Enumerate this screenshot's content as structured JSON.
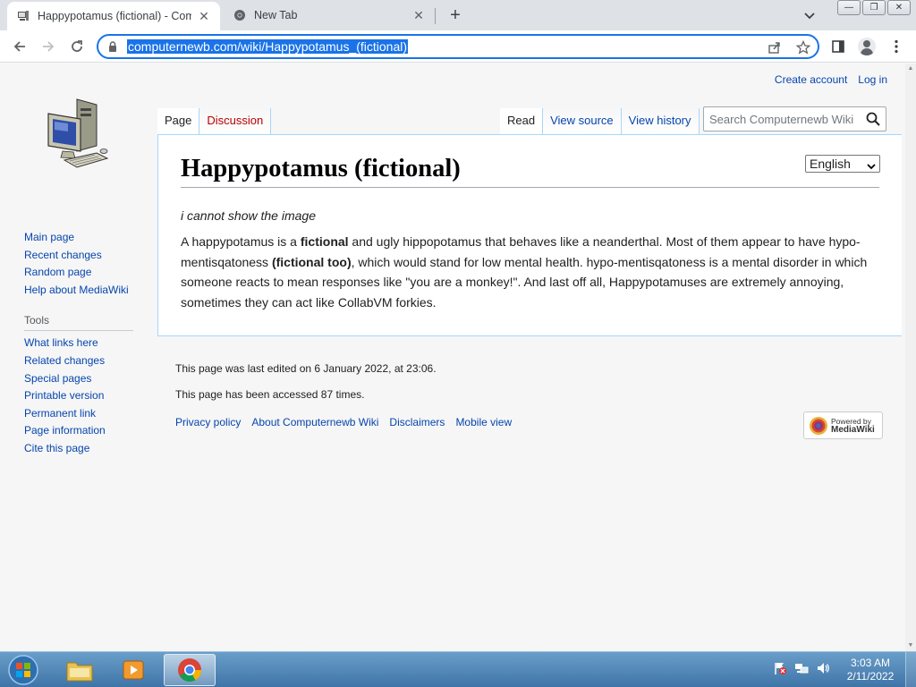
{
  "browser": {
    "tabs": [
      {
        "title": "Happypotamus (fictional) - Comp",
        "active": true
      },
      {
        "title": "New Tab",
        "active": false
      }
    ],
    "url": "computernewb.com/wiki/Happypotamus_(fictional)"
  },
  "wiki": {
    "personal": {
      "create_account": "Create account",
      "log_in": "Log in"
    },
    "nav_tabs_left": [
      "Page",
      "Discussion"
    ],
    "nav_tabs_right": [
      "Read",
      "View source",
      "View history"
    ],
    "search_placeholder": "Search Computernewb Wiki",
    "sidebar": {
      "navigation": [
        "Main page",
        "Recent changes",
        "Random page",
        "Help about MediaWiki"
      ],
      "tools_title": "Tools",
      "tools": [
        "What links here",
        "Related changes",
        "Special pages",
        "Printable version",
        "Permanent link",
        "Page information",
        "Cite this page"
      ]
    },
    "heading": "Happypotamus (fictional)",
    "language": "English",
    "image_alt": "i cannot show the image",
    "paragraph": {
      "p1": "A happypotamus is a ",
      "b1": "fictional",
      "p2": " and ugly hippopotamus that behaves like a neanderthal. Most of them appear to have hypo-mentisqatoness ",
      "b2": "(fictional too)",
      "p3": ", which would stand for low mental health. hypo-mentisqatoness is a mental disorder in which someone reacts to mean responses like \"you are a monkey!\". And last off all, Happypotamuses are extremely annoying, sometimes they can act like CollabVM forkies."
    },
    "footer": {
      "last_edited": "This page was last edited on 6 January 2022, at 23:06.",
      "accessed": "This page has been accessed 87 times.",
      "links": [
        "Privacy policy",
        "About Computernewb Wiki",
        "Disclaimers",
        "Mobile view"
      ],
      "powered_line1": "Powered by",
      "powered_line2": "MediaWiki"
    }
  },
  "taskbar": {
    "time": "3:03 AM",
    "date": "2/11/2022"
  }
}
